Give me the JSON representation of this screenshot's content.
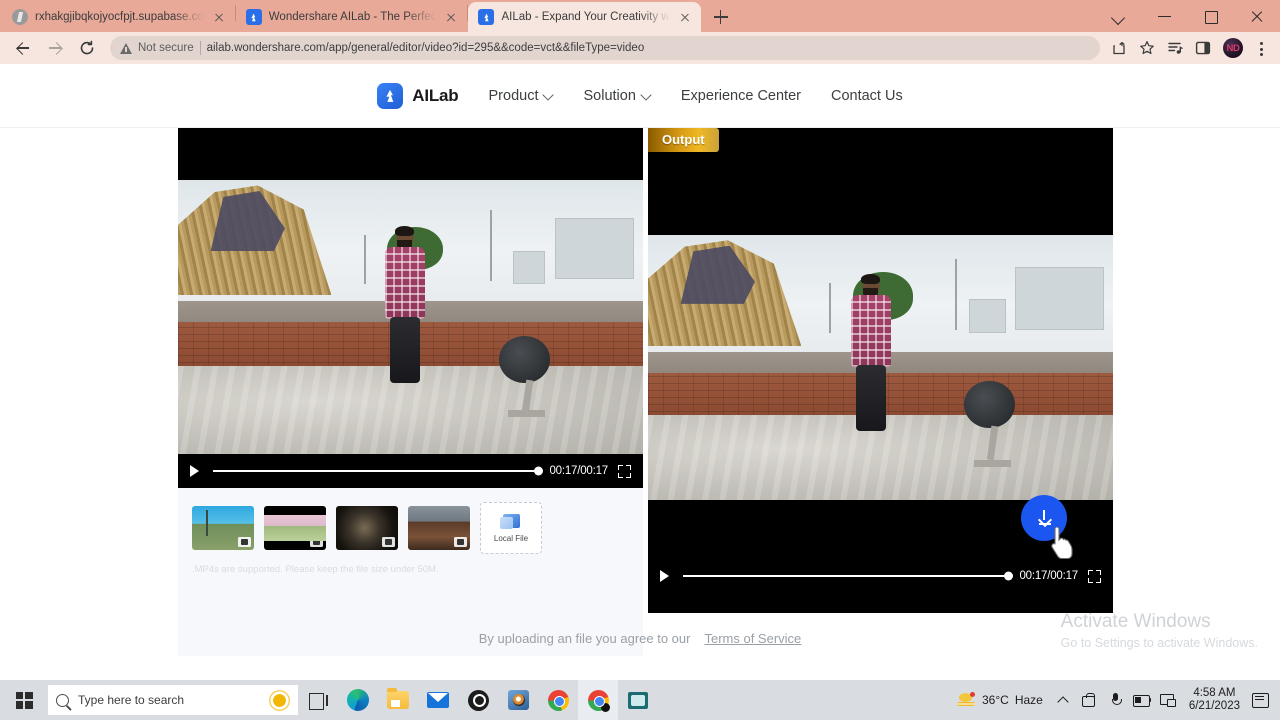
{
  "browser": {
    "tabs": [
      {
        "title": "rxhakgjibqkojyocfpjt.supabase.co",
        "favicon": "supabase-icon",
        "active": false
      },
      {
        "title": "Wondershare AILab - The Perfec",
        "favicon": "ailab-icon",
        "active": false
      },
      {
        "title": "AILab - Expand Your Creativity w",
        "favicon": "ailab-icon",
        "active": true
      }
    ],
    "new_tab_label": "+",
    "window_controls": [
      "chevron-down",
      "minimize",
      "maximize",
      "close"
    ],
    "omnibox": {
      "security_label": "Not secure",
      "url": "ailab.wondershare.com/app/general/editor/video?id=295&&code=vct&&fileType=video"
    },
    "toolbar_icons": [
      "share-icon",
      "bookmark-star-icon",
      "reading-list-icon",
      "side-panel-icon"
    ],
    "profile_initials": "ND"
  },
  "site": {
    "brand": "AILab",
    "nav": [
      {
        "label": "Product",
        "has_dropdown": true
      },
      {
        "label": "Solution",
        "has_dropdown": true
      },
      {
        "label": "Experience Center",
        "has_dropdown": false
      },
      {
        "label": "Contact Us",
        "has_dropdown": false
      }
    ]
  },
  "editor": {
    "source_player": {
      "current_time": "00:17",
      "duration": "00:17",
      "time_display": "00:17/00:17",
      "progress_percent": 100
    },
    "output_player": {
      "badge": "Output",
      "current_time": "00:17",
      "duration": "00:17",
      "time_display": "00:17/00:17",
      "progress_percent": 100
    },
    "download_button_label": "download-icon",
    "thumbnails": [
      {
        "name": "sample-railway"
      },
      {
        "name": "sample-blossom-road"
      },
      {
        "name": "sample-tire-closeup"
      },
      {
        "name": "sample-street-market"
      }
    ],
    "upload_tile": {
      "label": "Local File"
    },
    "hint": ".MP4s are supported. Please keep the file size under 50M.",
    "footer": {
      "text": "By uploading an file you agree to our",
      "link": "Terms of Service"
    }
  },
  "watermark": {
    "title": "Activate Windows",
    "subtitle": "Go to Settings to activate Windows."
  },
  "taskbar": {
    "search_placeholder": "Type here to search",
    "apps": [
      "task-view-icon",
      "edge-icon",
      "file-explorer-icon",
      "mail-icon",
      "obs-icon",
      "media-player-icon",
      "chrome-icon",
      "chrome-active-icon",
      "teal-app-icon"
    ],
    "weather": {
      "temperature": "36°C",
      "condition": "Haze"
    },
    "clock": {
      "time": "4:58 AM",
      "date": "6/21/2023"
    }
  },
  "colors": {
    "browser_chrome": "#e8a999",
    "accent_blue": "#1a56ef",
    "output_gold": "#f0b824",
    "brand_blue": "#2b6fe8"
  }
}
